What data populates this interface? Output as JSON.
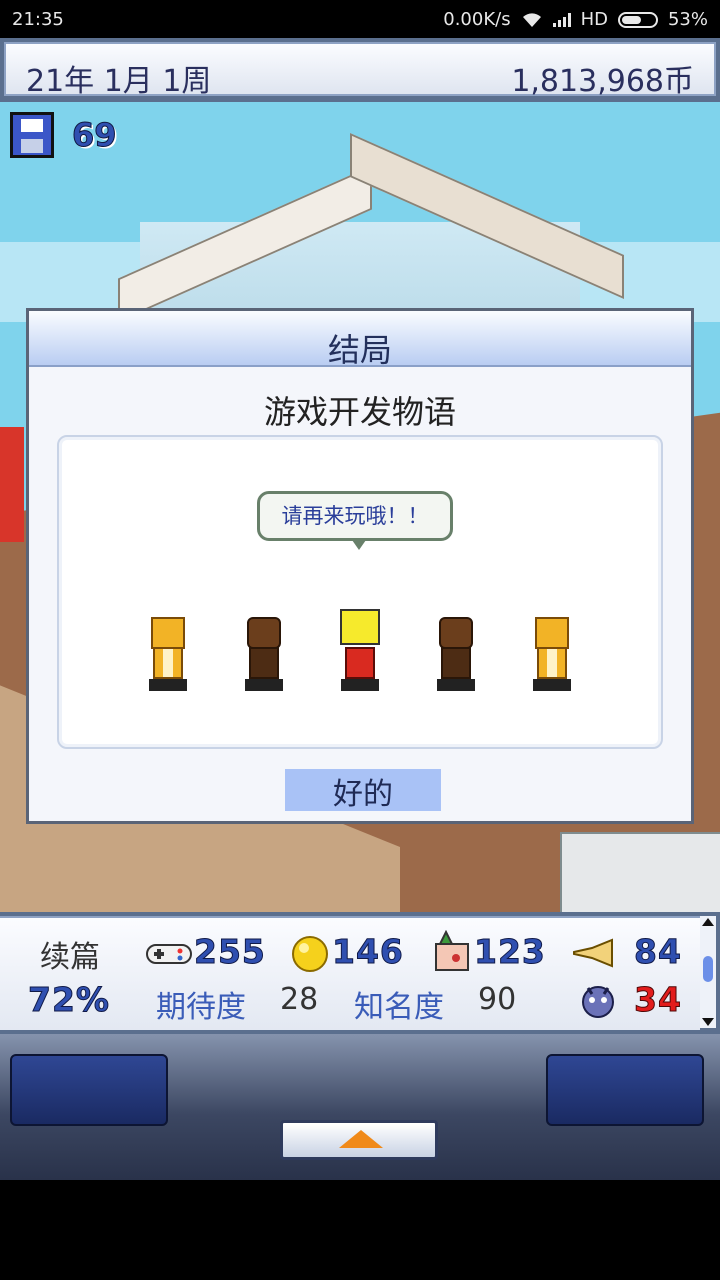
{
  "status_bar": {
    "time": "21:35",
    "speed": "0.00K/s",
    "network": "HD",
    "battery": "53%"
  },
  "top_bar": {
    "date": "21年 1月 1周",
    "money": "1,813,968币"
  },
  "save": {
    "count": "69"
  },
  "dialog": {
    "title": "结局",
    "game_name": "游戏开发物语",
    "speech": "请再来玩哦！！",
    "ok_label": "好的"
  },
  "stats": {
    "type_label": "续篇",
    "percent": "72%",
    "fun": "255",
    "creativity": "146",
    "graphics": "123",
    "sound": "84",
    "bugs": "34",
    "expectation_label": "期待度",
    "expectation_value": "28",
    "fame_label": "知名度",
    "fame_value": "90"
  },
  "colors": {
    "accent_blue": "#2f4fb0",
    "bug_red": "#e21c1c",
    "button_orange": "#f08a1a"
  }
}
